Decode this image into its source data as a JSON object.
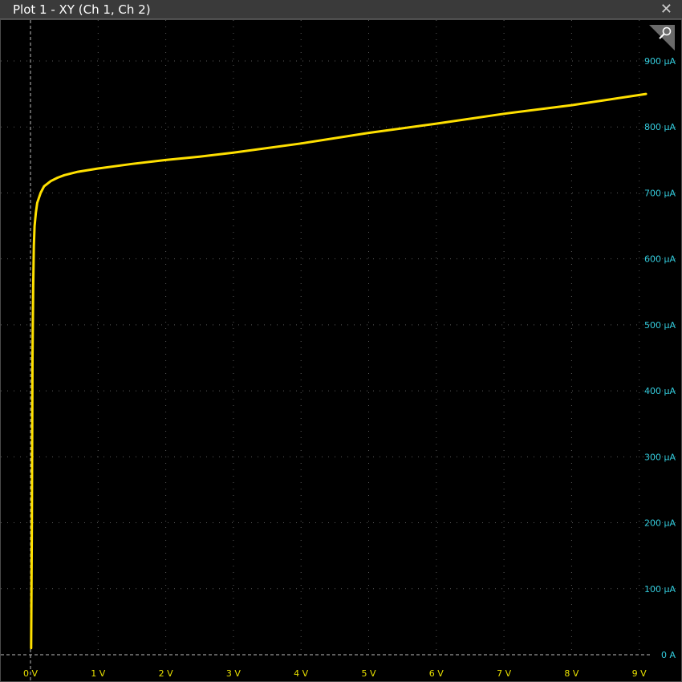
{
  "window": {
    "title": "Plot 1 - XY (Ch 1, Ch 2)",
    "close_icon": "close-icon",
    "corner_icon": "magnifier-icon"
  },
  "colors": {
    "background": "#000000",
    "trace": "#ffe000",
    "x_axis_labels": "#e8e000",
    "y_axis_labels": "#33ccdd",
    "grid": "#5a5a5a",
    "zero_lines": "#bdbdbd"
  },
  "chart_data": {
    "type": "line",
    "title": "Plot 1 - XY (Ch 1, Ch 2)",
    "xlabel": "",
    "ylabel": "",
    "xlim": [
      0,
      9
    ],
    "ylim": [
      0,
      900
    ],
    "x_ticks": [
      0,
      1,
      2,
      3,
      4,
      5,
      6,
      7,
      8,
      9
    ],
    "x_tick_labels": [
      "0 V",
      "1 V",
      "2 V",
      "3 V",
      "4 V",
      "5 V",
      "6 V",
      "7 V",
      "8 V",
      "9 V"
    ],
    "y_ticks": [
      0,
      100,
      200,
      300,
      400,
      500,
      600,
      700,
      800,
      900
    ],
    "y_tick_labels": [
      "0 A",
      "100 µA",
      "200 µA",
      "300 µA",
      "400 µA",
      "500 µA",
      "600 µA",
      "700 µA",
      "800 µA",
      "900 µA"
    ],
    "grid": true,
    "series": [
      {
        "x": [
          0.01,
          0.02,
          0.03,
          0.04,
          0.05,
          0.06,
          0.08,
          0.1,
          0.15,
          0.2,
          0.3,
          0.4,
          0.5,
          0.7,
          1.0,
          1.5,
          2.0,
          2.5,
          3.0,
          4.0,
          5.0,
          6.0,
          7.0,
          8.0,
          9.1
        ],
        "y": [
          10,
          200,
          450,
          560,
          620,
          650,
          670,
          685,
          700,
          710,
          718,
          723,
          727,
          732,
          737,
          744,
          750,
          755,
          761,
          775,
          791,
          805,
          820,
          833,
          850
        ]
      }
    ]
  }
}
